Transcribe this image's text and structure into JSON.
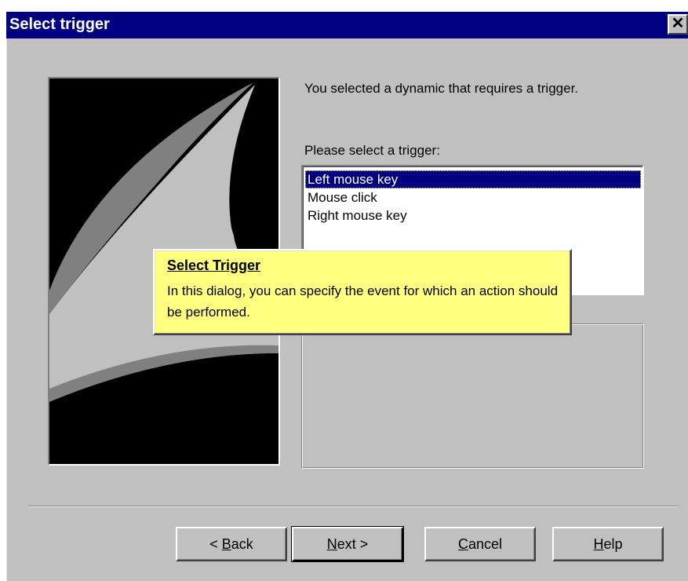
{
  "window": {
    "title": "Select trigger",
    "close_glyph": "✕"
  },
  "intro_text": "You selected a dynamic that requires a trigger.",
  "trigger_label": "Please select a trigger:",
  "trigger_list": {
    "items": [
      "Left mouse key",
      "Mouse click",
      "Right mouse key"
    ],
    "selected": "Left mouse key"
  },
  "tooltip": {
    "title": "Select Trigger",
    "body": "In this dialog, you can specify the event for which an action should be performed."
  },
  "buttons": {
    "back": {
      "prefix": "< ",
      "mnemonic": "B",
      "rest": "ack"
    },
    "next": {
      "mnemonic": "N",
      "rest": "ext >"
    },
    "cancel": {
      "mnemonic": "C",
      "rest": "ancel"
    },
    "help": {
      "mnemonic": "H",
      "rest": "elp"
    }
  },
  "colors": {
    "titlebar": "#000080",
    "face": "#c0c0c0",
    "selection": "#000080",
    "tooltip_bg": "#ffff80"
  }
}
